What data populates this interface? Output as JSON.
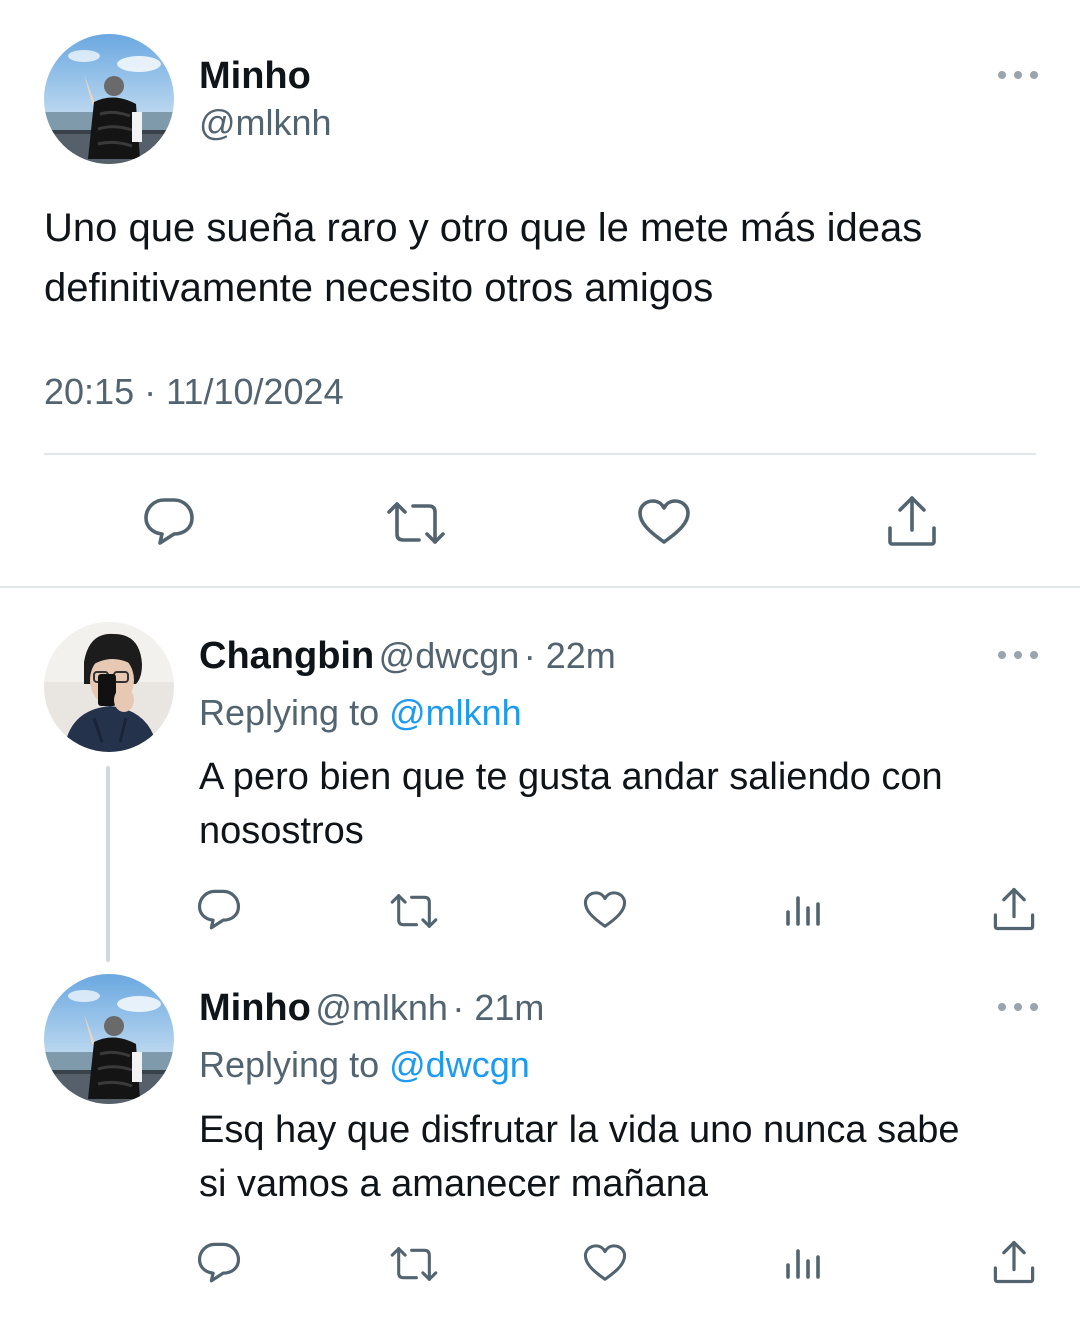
{
  "main_tweet": {
    "name": "Minho",
    "handle": "@mlknh",
    "text_line1": "Uno que sueña raro y otro que le mete más ideas",
    "text_line2": "definitivamente necesito otros amigos",
    "timestamp": "20:15 · 11/10/2024"
  },
  "replies": [
    {
      "name": "Changbin",
      "handle": "@dwcgn",
      "age": "· 22m",
      "replying_prefix": "Replying to",
      "replying_to": "@mlknh",
      "text_line1": "A pero bien que te gusta andar saliendo con",
      "text_line2": "nosostros"
    },
    {
      "name": "Minho",
      "handle": "@mlknh",
      "age": "· 21m",
      "replying_prefix": "Replying to",
      "replying_to": "@dwcgn",
      "text_line1": "Esq hay que disfrutar la vida uno nunca sabe",
      "text_line2": "si vamos a amanecer mañana"
    }
  ],
  "icons": {
    "reply": "reply-bubble-icon",
    "retweet": "retweet-arrows-icon",
    "like": "heart-icon",
    "views": "bar-chart-icon",
    "share": "share-upload-icon",
    "more": "more-dots-icon"
  },
  "colors": {
    "text": "#0f1419",
    "secondary": "#536471",
    "mention": "#1d9bf0",
    "divider": "#e1e6ea"
  }
}
